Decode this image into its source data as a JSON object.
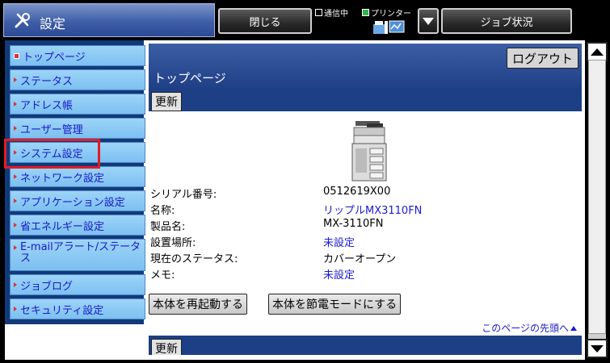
{
  "header": {
    "title": "設定",
    "close_label": "閉じる",
    "job_status_label": "ジョブ状況",
    "communicating_label": "通信中",
    "printer_label": "プリンター"
  },
  "sidebar": {
    "items": [
      {
        "label": "トップページ",
        "name": "sidebar-item-top-page"
      },
      {
        "label": "ステータス",
        "name": "sidebar-item-status"
      },
      {
        "label": "アドレス帳",
        "name": "sidebar-item-address-book"
      },
      {
        "label": "ユーザー管理",
        "name": "sidebar-item-user-management"
      },
      {
        "label": "システム設定",
        "name": "sidebar-item-system-settings"
      },
      {
        "label": "ネットワーク設定",
        "name": "sidebar-item-network-settings"
      },
      {
        "label": "アプリケーション設定",
        "name": "sidebar-item-application-settings"
      },
      {
        "label": "省エネルギー設定",
        "name": "sidebar-item-energy-saving"
      },
      {
        "label": "E-mailアラート/ステータス",
        "name": "sidebar-item-email-alert"
      },
      {
        "label": "ジョブログ",
        "name": "sidebar-item-job-log"
      },
      {
        "label": "セキュリティ設定",
        "name": "sidebar-item-security-settings"
      }
    ]
  },
  "main": {
    "logout_label": "ログアウト",
    "page_title": "トップページ",
    "refresh_label": "更新",
    "info": [
      {
        "label": "シリアル番号:",
        "value": "0512619X00",
        "link": false
      },
      {
        "label": "名称:",
        "value": "リップルMX3110FN",
        "link": true
      },
      {
        "label": "製品名:",
        "value": "MX-3110FN",
        "link": false
      },
      {
        "label": "設置場所:",
        "value": "未設定",
        "link": true
      },
      {
        "label": "現在のステータス:",
        "value": "カバーオープン",
        "link": false
      },
      {
        "label": "メモ:",
        "value": "未設定",
        "link": true
      }
    ],
    "restart_label": "本体を再起動する",
    "power_save_label": "本体を節電モードにする",
    "to_top_label": "このページの先頭へ"
  },
  "colors": {
    "nav_text": "#1818c8",
    "highlight": "#e21c25",
    "link": "#1a1ad0",
    "band": "#1c3f86"
  }
}
